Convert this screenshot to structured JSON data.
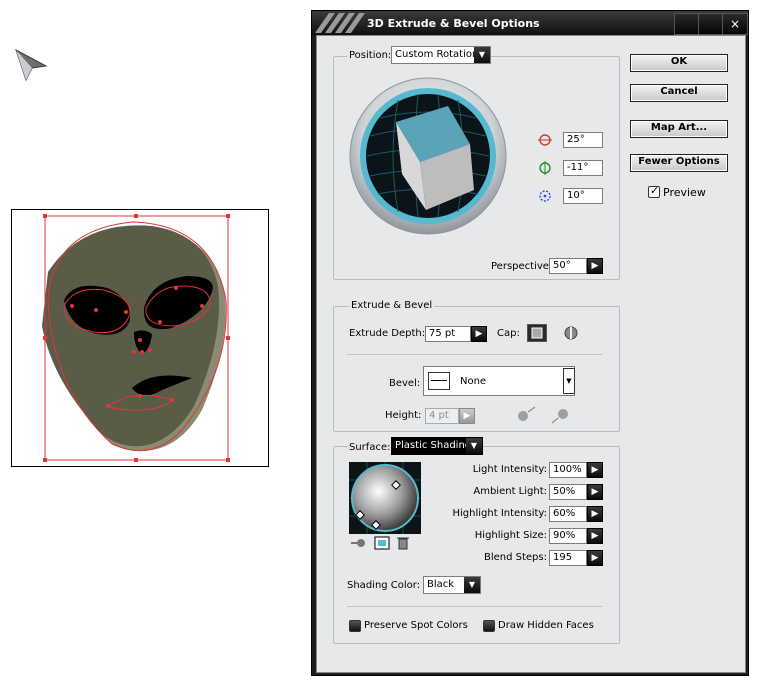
{
  "dialog": {
    "title": "3D Extrude & Bevel Options",
    "title_buttons": [
      "",
      "",
      "×"
    ],
    "buttons": {
      "ok": "OK",
      "cancel": "Cancel",
      "map_art": "Map Art...",
      "fewer_options": "Fewer Options"
    },
    "preview": {
      "label": "Preview",
      "checked": true
    }
  },
  "position": {
    "label": "Position:",
    "value": "Custom Rotation",
    "x_rotation": "25°",
    "y_rotation": "-11°",
    "z_rotation": "10°",
    "perspective_label": "Perspective:",
    "perspective_value": "50°"
  },
  "extrude": {
    "section_label": "Extrude & Bevel",
    "depth_label": "Extrude Depth:",
    "depth_value": "75 pt",
    "cap_label": "Cap:",
    "bevel_label": "Bevel:",
    "bevel_value": "None",
    "height_label": "Height:",
    "height_value": "4 pt"
  },
  "surface": {
    "label": "Surface:",
    "value": "Plastic Shading",
    "light_intensity_label": "Light Intensity:",
    "light_intensity_value": "100%",
    "ambient_light_label": "Ambient Light:",
    "ambient_light_value": "50%",
    "highlight_intensity_label": "Highlight Intensity:",
    "highlight_intensity_value": "60%",
    "highlight_size_label": "Highlight Size:",
    "highlight_size_value": "90%",
    "blend_steps_label": "Blend Steps:",
    "blend_steps_value": "195",
    "shading_color_label": "Shading Color:",
    "shading_color_value": "Black",
    "preserve_spot_colors": "Preserve Spot Colors",
    "draw_hidden_faces": "Draw Hidden Faces"
  },
  "colors": {
    "cube_face": "#5aa3b8",
    "alien_skin": "#5a5c47",
    "selection": "#e0353b",
    "dialog_bg": "#e6e8ea"
  },
  "icons": {
    "cursor": "selection-arrow-icon",
    "x_rotation": "rotate-x-icon",
    "y_rotation": "rotate-y-icon",
    "z_rotation": "rotate-z-icon"
  }
}
